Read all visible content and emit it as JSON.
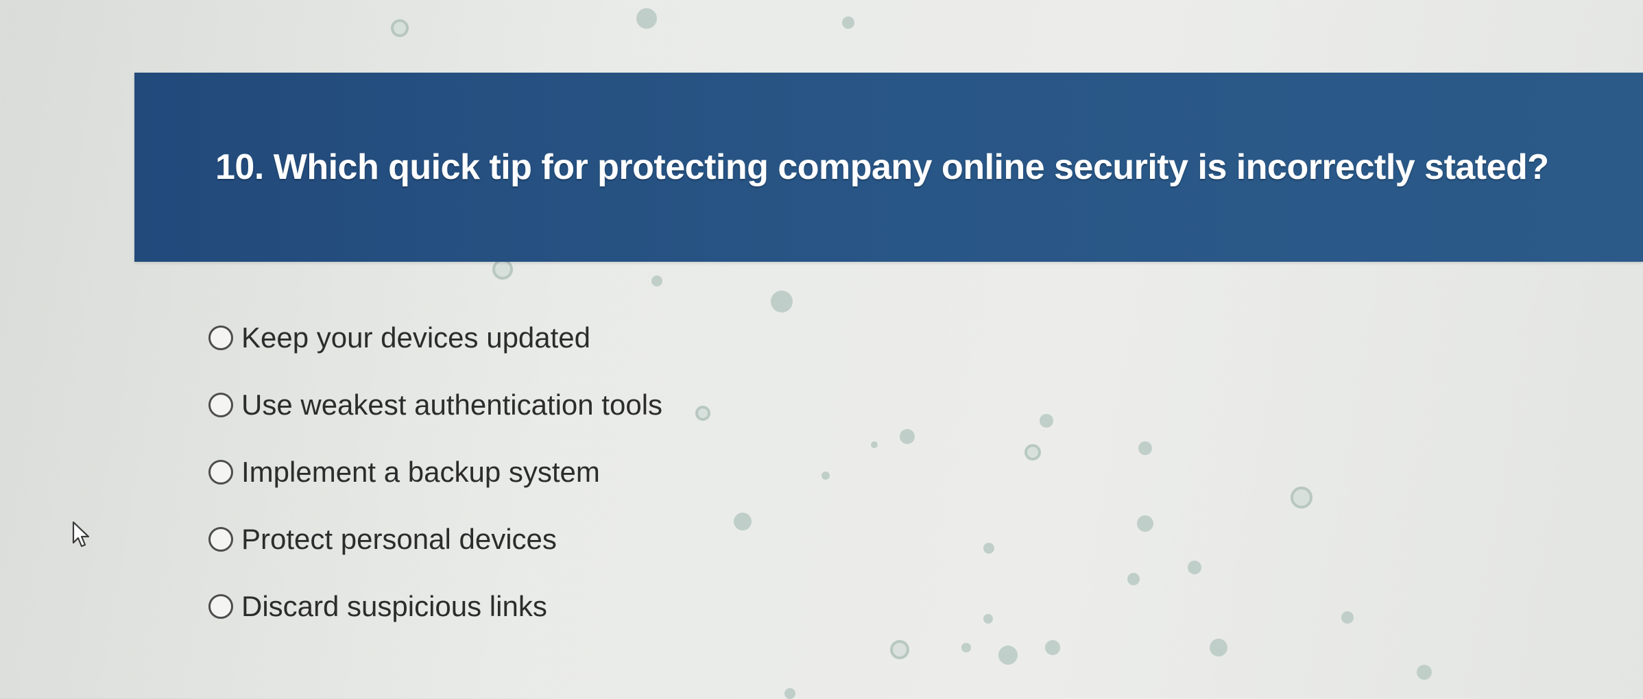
{
  "question": {
    "number": "10.",
    "text": "Which quick tip for protecting company online security is incorrectly stated?",
    "full": "10. Which quick tip for protecting company online security is incorrectly stated?"
  },
  "options": [
    {
      "label": "Keep your devices updated",
      "selected": false
    },
    {
      "label": "Use weakest authentication tools",
      "selected": false
    },
    {
      "label": "Implement a backup system",
      "selected": false
    },
    {
      "label": "Protect personal devices",
      "selected": false
    },
    {
      "label": "Discard suspicious links",
      "selected": false
    }
  ],
  "colors": {
    "banner": "#285585",
    "banner_text": "#ffffff",
    "page_background": "#e9ebe8",
    "option_text": "#2c2c2c",
    "radio_border": "#4d4d4d"
  },
  "icons": {
    "cursor": "mouse-pointer-icon",
    "radio": "radio-unchecked-icon"
  }
}
